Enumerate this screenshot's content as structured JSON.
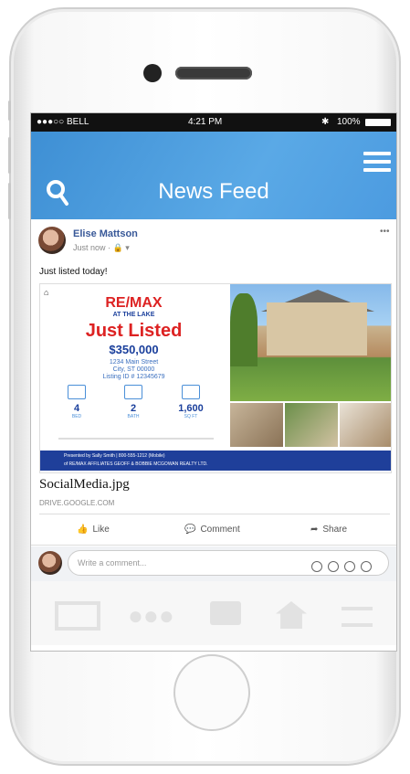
{
  "status": {
    "carrier": "●●●○○ BELL",
    "time": "4:21 PM",
    "battery": "100%"
  },
  "app": {
    "title": "News Feed"
  },
  "post": {
    "author": "Elise Mattson",
    "meta": "Just now · 🔒 ▾",
    "text": "Just listed today!",
    "ad": {
      "brand": "RE/MAX",
      "brand_sub": "AT THE LAKE",
      "headline": "Just Listed",
      "price": "$350,000",
      "address1": "1234 Main Street",
      "address2": "City, ST 00000",
      "listing_id": "Listing ID # 12345679",
      "features": [
        {
          "value": "4",
          "label": "BED"
        },
        {
          "value": "2",
          "label": "BATH"
        },
        {
          "value": "1,600",
          "label": "SQ FT"
        }
      ],
      "banner1": "Presented by Sally Smith | 800-555-1212 (Mobile)",
      "banner2": "of RE/MAX AFFILIATES GEOFF & BOBBIE MCGOWAN REALTY LTD."
    },
    "attachment": {
      "filename": "SocialMedia.jpg",
      "domain": "DRIVE.GOOGLE.COM"
    },
    "actions": {
      "like": "Like",
      "comment": "Comment",
      "share": "Share"
    }
  },
  "comment": {
    "placeholder": "Write a comment..."
  }
}
